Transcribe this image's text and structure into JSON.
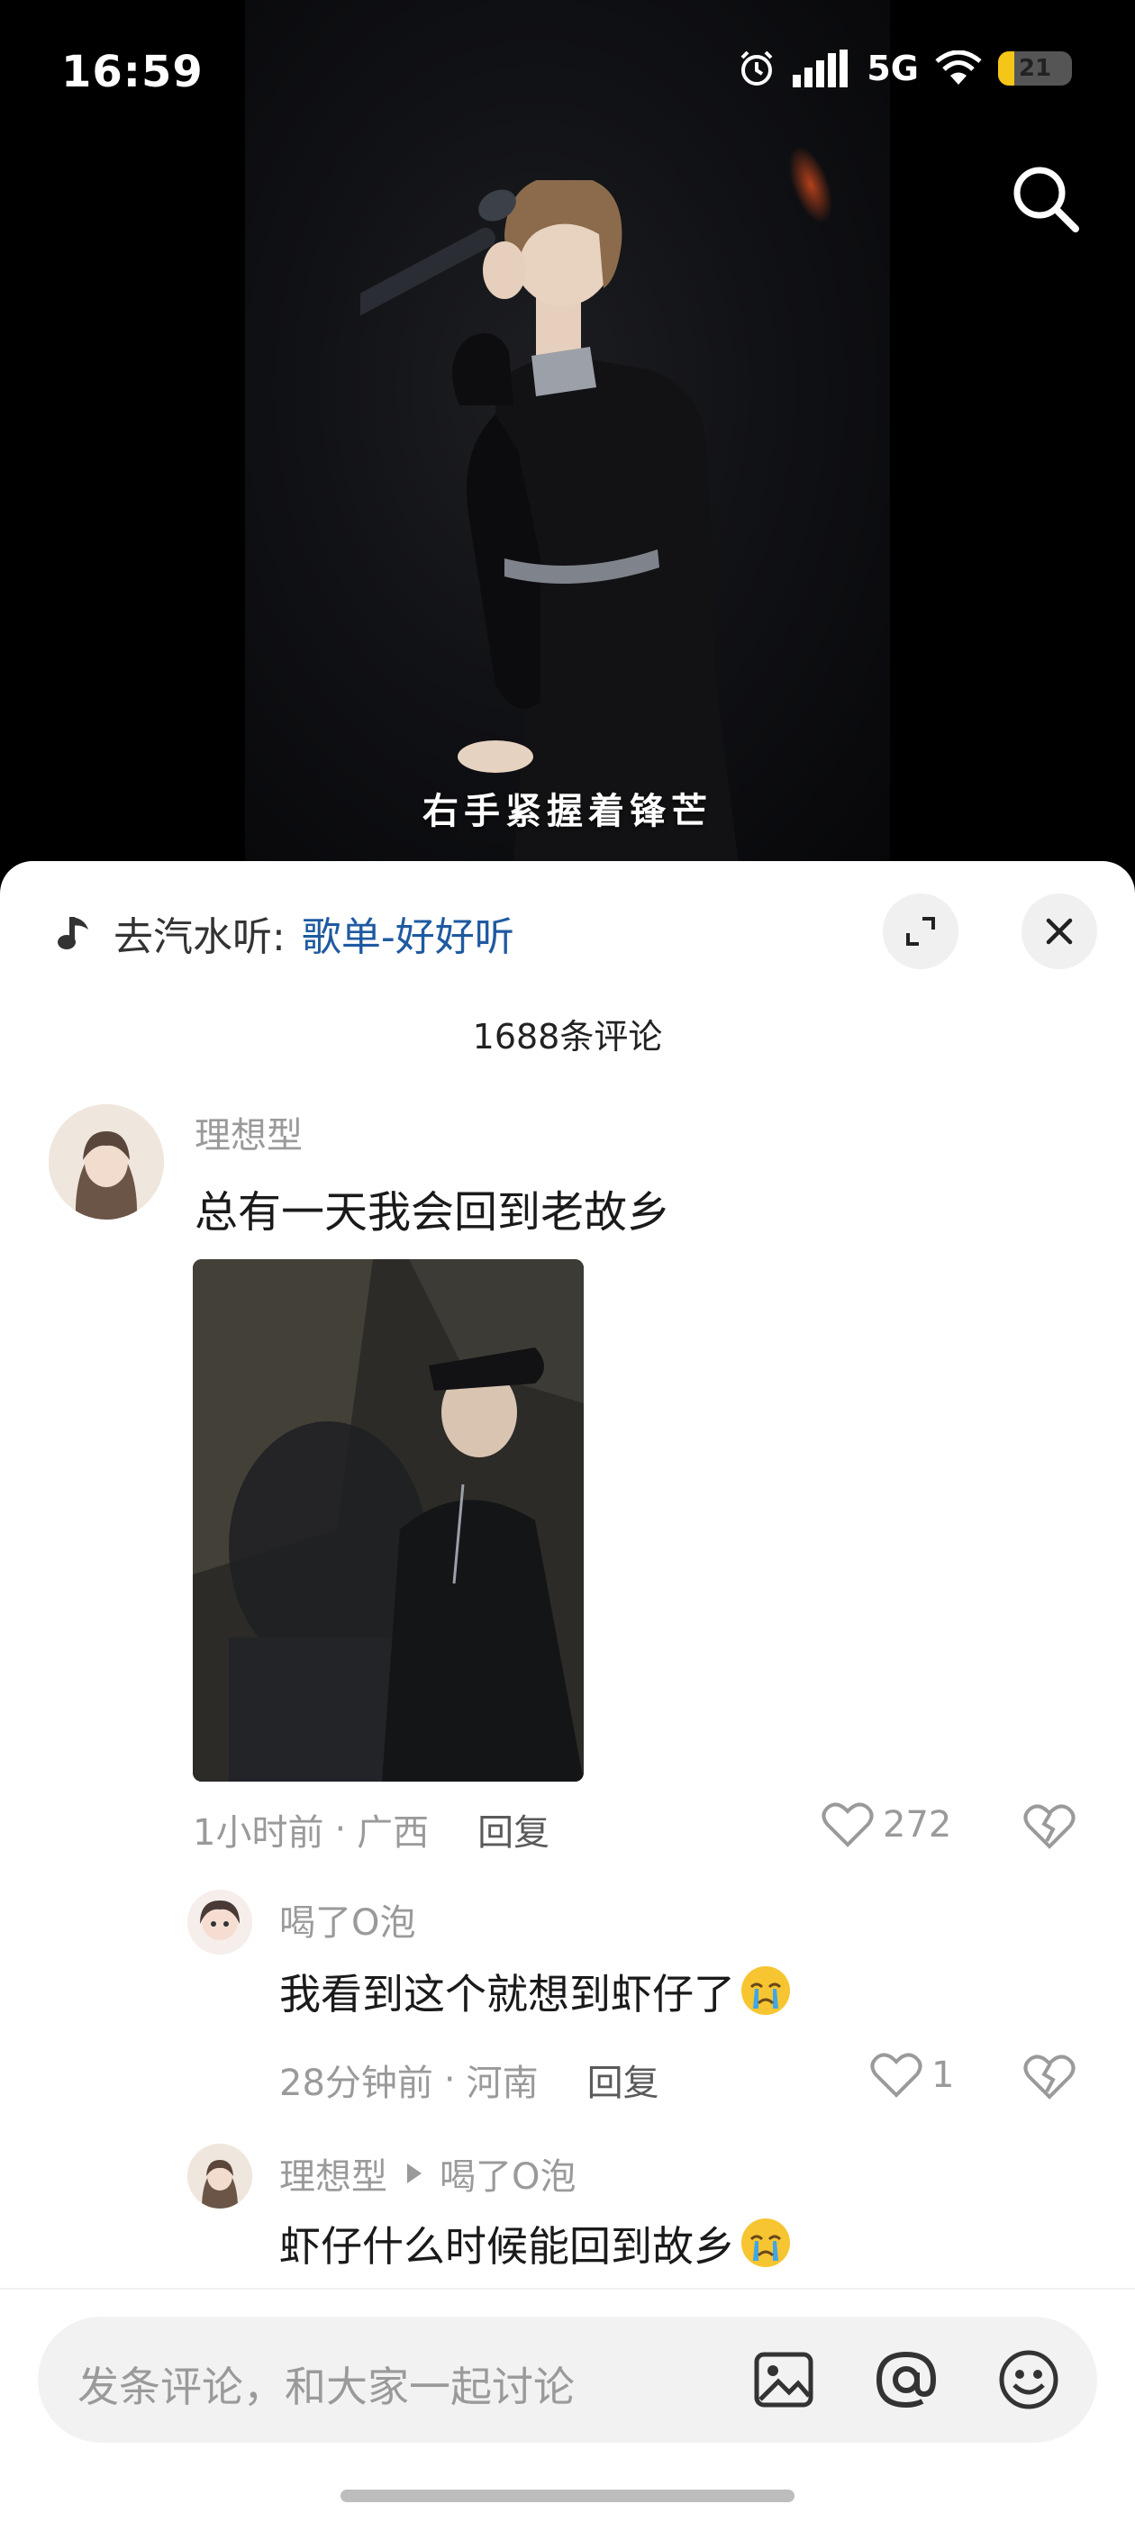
{
  "status_bar": {
    "time": "16:59",
    "network": "5G",
    "battery": "21"
  },
  "video": {
    "subtitle": "右手紧握着锋芒"
  },
  "music": {
    "prefix": "去汽水听:",
    "playlist": "歌单-好好听"
  },
  "comments": {
    "count_label": "1688条评论",
    "items": [
      {
        "user": "理想型",
        "text": "总有一天我会回到老故乡",
        "time": "1小时前",
        "location": "广西",
        "reply_label": "回复",
        "likes": "272"
      },
      {
        "user": "喝了O泡",
        "text": "我看到这个就想到虾仔了",
        "time": "28分钟前",
        "location": "河南",
        "reply_label": "回复",
        "likes": "1"
      },
      {
        "user": "理想型",
        "reply_to": "喝了O泡",
        "text": "虾仔什么时候能回到故乡"
      }
    ]
  },
  "input": {
    "placeholder": "发条评论，和大家一起讨论"
  },
  "colors": {
    "link": "#1f5aa0",
    "muted": "#9a9a9a",
    "battery": "#f5c518"
  }
}
